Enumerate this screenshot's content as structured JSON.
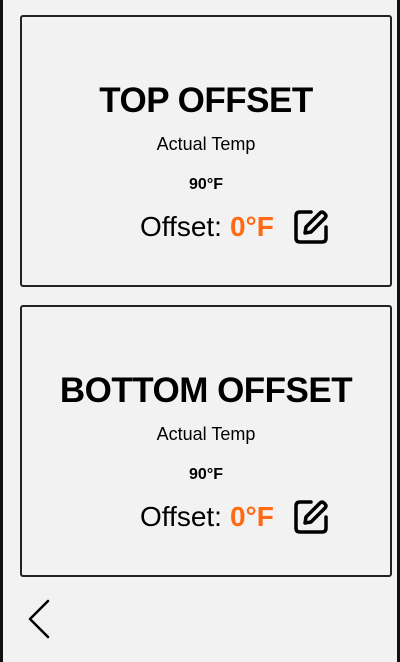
{
  "cards": [
    {
      "title": "TOP OFFSET",
      "actual_label": "Actual Temp",
      "actual_value": "90°F",
      "offset_label": "Offset:",
      "offset_value": "0°F"
    },
    {
      "title": "BOTTOM OFFSET",
      "actual_label": "Actual Temp",
      "actual_value": "90°F",
      "offset_label": "Offset:",
      "offset_value": "0°F"
    }
  ],
  "icons": {
    "edit": "edit-icon",
    "back": "chevron-left-icon"
  },
  "colors": {
    "background": "#f2f2f2",
    "accent": "#ff6a13",
    "border": "#222222"
  }
}
